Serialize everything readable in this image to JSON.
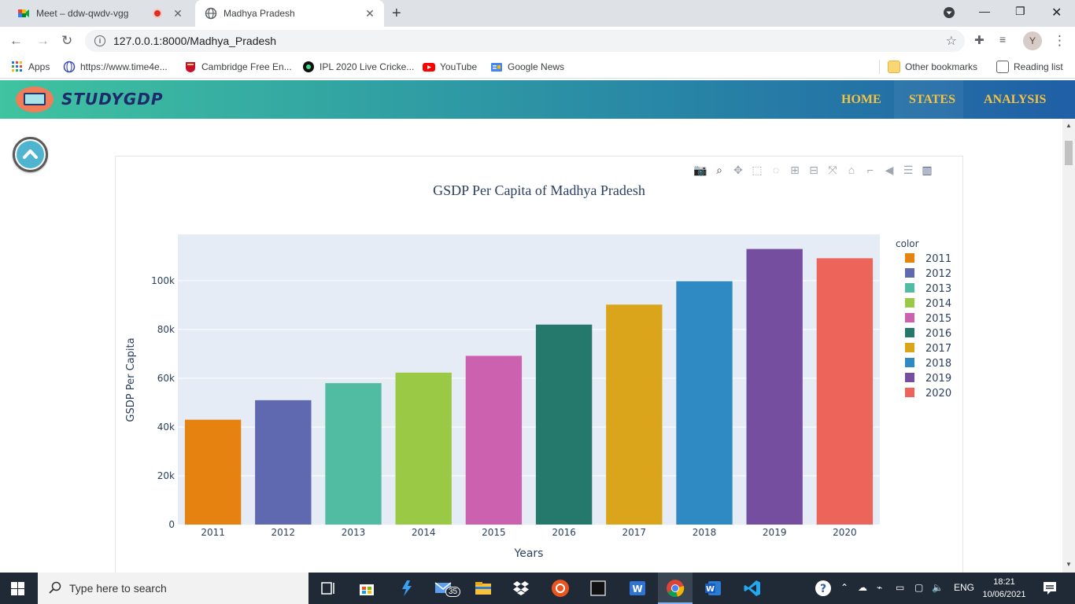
{
  "browser": {
    "tabs": [
      {
        "title": "Meet – ddw-qwdv-vgg",
        "active": false
      },
      {
        "title": "Madhya Pradesh",
        "active": true
      }
    ],
    "url": "127.0.0.1:8000/Madhya_Pradesh",
    "profile_initial": "Y",
    "bookmarks": [
      {
        "label": "Apps",
        "icon": "apps-grid-icon"
      },
      {
        "label": "https://www.time4e...",
        "icon": "globe-icon"
      },
      {
        "label": "Cambridge Free En...",
        "icon": "cambridge-shield-icon"
      },
      {
        "label": "IPL 2020 Live Cricke...",
        "icon": "cricket-icon"
      },
      {
        "label": "YouTube",
        "icon": "youtube-icon"
      },
      {
        "label": "Google News",
        "icon": "google-news-icon"
      }
    ],
    "other_bookmarks": "Other bookmarks",
    "reading_list": "Reading list"
  },
  "site": {
    "logo_text": "STUDYGDP",
    "nav": [
      "HOME",
      "STATES",
      "ANALYSIS"
    ]
  },
  "chart_data": {
    "type": "bar",
    "title": "GSDP Per Capita of Madhya Pradesh",
    "xlabel": "Years",
    "ylabel": "GSDP Per Capita",
    "categories": [
      "2011",
      "2012",
      "2013",
      "2014",
      "2015",
      "2016",
      "2017",
      "2018",
      "2019",
      "2020"
    ],
    "values": [
      43000,
      51000,
      58000,
      62300,
      69200,
      82000,
      90200,
      99800,
      113000,
      109200
    ],
    "colors": [
      "#e68310",
      "#5f69b0",
      "#52bca3",
      "#99c945",
      "#cc61b0",
      "#24796c",
      "#daa51b",
      "#2f8ac4",
      "#764e9f",
      "#ed645a"
    ],
    "ylim": [
      0,
      119000
    ],
    "yticks": [
      0,
      20000,
      40000,
      60000,
      80000,
      100000
    ],
    "ytick_labels": [
      "0",
      "20k",
      "40k",
      "60k",
      "80k",
      "100k"
    ],
    "legend_title": "color",
    "legend_position": "right",
    "grid": true,
    "plot_bg": "#e5ecf6"
  },
  "taskbar": {
    "search_placeholder": "Type here to search",
    "mail_badge": "35",
    "language": "ENG",
    "time": "18:21",
    "date": "10/06/2021"
  }
}
